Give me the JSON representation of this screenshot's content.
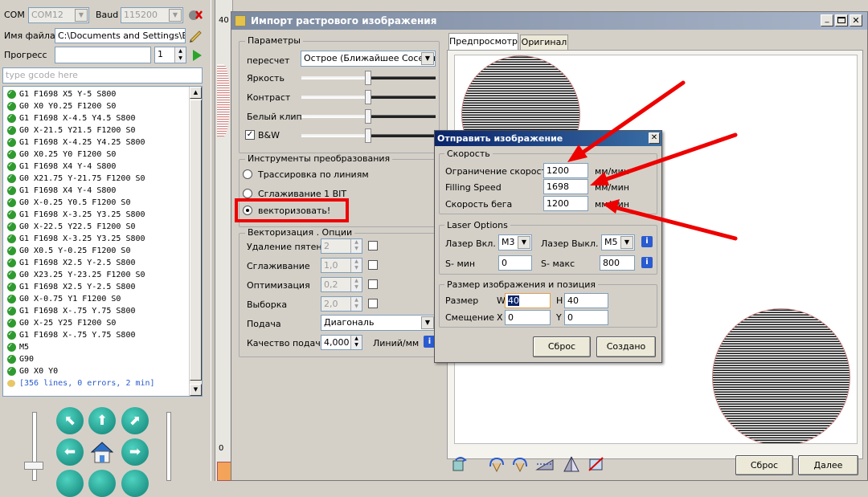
{
  "left_panel": {
    "com_label": "COM",
    "com_value": "COM12",
    "baud_label": "Baud",
    "baud_value": "115200",
    "file_label": "Имя файла",
    "file_value": "C:\\Documents and Settings\\EA\\",
    "progress_label": "Прогресс",
    "progress_count": "1",
    "gcode_placeholder": "type gcode here",
    "gcode_lines": [
      "G1 F1698 X5 Y-5 S800",
      "G0 X0 Y0.25 F1200 S0",
      "G1 F1698 X-4.5 Y4.5 S800",
      "G0 X-21.5 Y21.5 F1200 S0",
      "G1 F1698 X-4.25 Y4.25 S800",
      "G0 X0.25 Y0 F1200 S0",
      "G1 F1698 X4 Y-4 S800",
      "G0 X21.75 Y-21.75 F1200 S0",
      "G1 F1698 X4 Y-4 S800",
      "G0 X-0.25 Y0.5 F1200 S0",
      "G1 F1698 X-3.25 Y3.25 S800",
      "G0 X-22.5 Y22.5 F1200 S0",
      "G1 F1698 X-3.25 Y3.25 S800",
      "G0 X0.5 Y-0.25 F1200 S0",
      "G1 F1698 X2.5 Y-2.5 S800",
      "G0 X23.25 Y-23.25 F1200 S0",
      "G1 F1698 X2.5 Y-2.5 S800",
      "G0 X-0.75 Y1 F1200 S0",
      "G1 F1698 X-.75 Y.75 S800",
      "G0 X-25 Y25 F1200 S0",
      "G1 F1698 X-.75 Y.75 S800",
      "M5",
      "G90",
      "G0 X0 Y0"
    ],
    "gcode_summary": "[356 lines, 0 errors, 2 min]"
  },
  "ruler": {
    "top_value": "40",
    "bottom_value": "0"
  },
  "import_window": {
    "title": "Импорт растрового изображения",
    "params": {
      "title": "Параметры",
      "resample_label": "пересчет",
      "resample_value": "Острое (Ближайшее Соседнее)",
      "brightness_label": "Яркость",
      "contrast_label": "Контраст",
      "white_clip_label": "Белый клип",
      "bw_label": "B&W"
    },
    "tools": {
      "title": "Инструменты преобразования",
      "opt1": "Трассировка по линиям",
      "opt2": "Сглаживание 1 BIT",
      "opt3": "векторизовать!"
    },
    "vector": {
      "title": "Векторизация . Опции",
      "spot_label": "Удаление пятен",
      "spot_value": "2",
      "smooth_label": "Сглаживание",
      "smooth_value": "1,0",
      "optim_label": "Оптимизация",
      "optim_value": "0,2",
      "sample_label": "Выборка",
      "sample_value": "2,0",
      "feed_label": "Подача",
      "feed_value": "Диагональ",
      "quality_label": "Качество подачи",
      "quality_value": "4,000",
      "quality_unit": "Линий/мм"
    },
    "tabs": {
      "preview": "Предпросмотр",
      "original": "Оригинал"
    },
    "reset_button": "Сброс",
    "next_button": "Далее"
  },
  "send_dialog": {
    "title": "Отправить изображение",
    "speed": {
      "title": "Скорость",
      "limit_label": "Ограничение скорости",
      "limit_value": "1200",
      "limit_unit": "мм/мин",
      "fill_label": "Filling Speed",
      "fill_value": "1698",
      "fill_unit": "мм/мин",
      "travel_label": "Скорость бега",
      "travel_value": "1200",
      "travel_unit": "мм/мин"
    },
    "laser": {
      "title": "Laser Options",
      "on_label": "Лазер Вкл.",
      "on_value": "M3",
      "off_label": "Лазер Выкл.",
      "off_value": "M5",
      "smin_label": "S- мин",
      "smin_value": "0",
      "smax_label": "S- макс",
      "smax_value": "800"
    },
    "size": {
      "title": "Размер изображения и позиция",
      "size_label": "Размер",
      "w_label": "W",
      "w_value": "40",
      "h_label": "H",
      "h_value": "40",
      "offset_label": "Смещение",
      "x_label": "X",
      "x_value": "0",
      "y_label": "Y",
      "y_value": "0"
    },
    "reset_button": "Сброс",
    "create_button": "Создано"
  },
  "colors": {
    "accent_red": "#ee0000",
    "title_blue": "#0a246a",
    "ok_green": "#2f9a2f"
  }
}
